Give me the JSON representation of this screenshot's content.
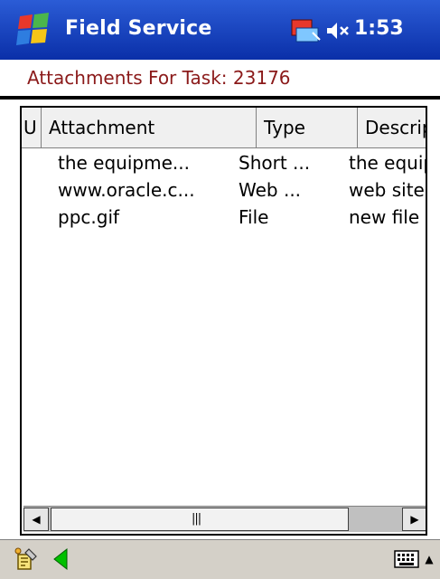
{
  "titlebar": {
    "app_title": "Field Service",
    "clock": "1:53"
  },
  "page": {
    "title": "Attachments For Task: 23176"
  },
  "list": {
    "columns": [
      "U",
      "Attachment",
      "Type",
      "Descriptio"
    ],
    "rows": [
      {
        "attachment": "the equipme...",
        "type": "Short ...",
        "description": "the equip"
      },
      {
        "attachment": "www.oracle.c...",
        "type": "Web ...",
        "description": "web site"
      },
      {
        "attachment": "ppc.gif",
        "type": "File",
        "description": "new file"
      }
    ]
  },
  "icons": {
    "start": "windows-flag-icon",
    "connectivity": "connectivity-icon",
    "volume": "speaker-muted-icon",
    "row_status": "pencil-icon",
    "toolbar_tool": "tools-icon",
    "toolbar_back": "back-arrow-icon",
    "keyboard": "keyboard-icon"
  },
  "colors": {
    "titlebar": "#1a47c8",
    "page_title": "#8b1a1a",
    "back_arrow": "#00c000"
  }
}
